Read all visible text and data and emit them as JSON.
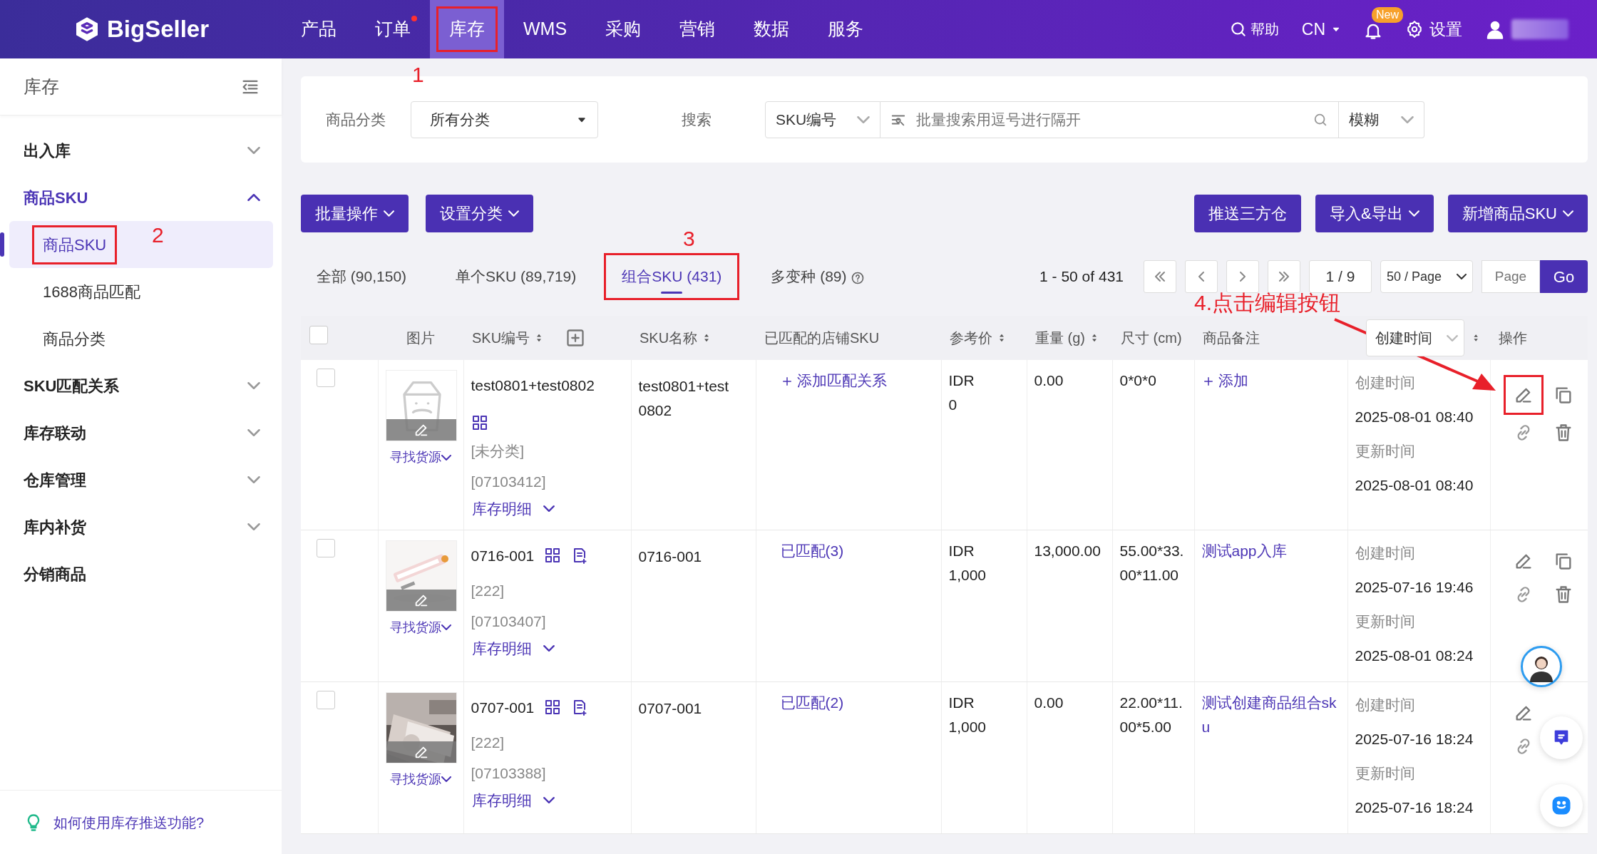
{
  "navbar": {
    "brand": "BigSeller",
    "menu": [
      {
        "label": "产品",
        "selected": false,
        "dot": false,
        "highlight": false
      },
      {
        "label": "订单",
        "selected": false,
        "dot": true,
        "highlight": false
      },
      {
        "label": "库存",
        "selected": true,
        "dot": false,
        "highlight": true
      },
      {
        "label": "WMS",
        "selected": false,
        "dot": false,
        "highlight": false
      },
      {
        "label": "采购",
        "selected": false,
        "dot": false,
        "highlight": false
      },
      {
        "label": "营销",
        "selected": false,
        "dot": false,
        "highlight": false
      },
      {
        "label": "数据",
        "selected": false,
        "dot": false,
        "highlight": false
      },
      {
        "label": "服务",
        "selected": false,
        "dot": false,
        "highlight": false
      }
    ],
    "help": "帮助",
    "language": "CN",
    "new_badge": "New",
    "settings": "设置"
  },
  "sidebar": {
    "title": "库存",
    "items": [
      {
        "label": "出入库",
        "kind": "group",
        "expanded": false,
        "selected": false
      },
      {
        "label": "商品SKU",
        "kind": "group",
        "expanded": true,
        "selected": true,
        "children": [
          {
            "label": "商品SKU",
            "selected": true,
            "highlight": true
          },
          {
            "label": "1688商品匹配",
            "selected": false,
            "highlight": false
          },
          {
            "label": "商品分类",
            "selected": false,
            "highlight": false
          }
        ]
      },
      {
        "label": "SKU匹配关系",
        "kind": "group",
        "expanded": false,
        "selected": false
      },
      {
        "label": "库存联动",
        "kind": "group",
        "expanded": false,
        "selected": false
      },
      {
        "label": "仓库管理",
        "kind": "group",
        "expanded": false,
        "selected": false
      },
      {
        "label": "库内补货",
        "kind": "group",
        "expanded": false,
        "selected": false
      },
      {
        "label": "分销商品",
        "kind": "link",
        "selected": false
      }
    ],
    "tip": "如何使用库存推送功能?"
  },
  "filters": {
    "category_label": "商品分类",
    "category_value": "所有分类",
    "search_label": "搜索",
    "search_type": "SKU编号",
    "search_placeholder": "批量搜索用逗号进行隔开",
    "match_mode": "模糊"
  },
  "actions_left": [
    {
      "label": "批量操作",
      "dropdown": true
    },
    {
      "label": "设置分类",
      "dropdown": true
    }
  ],
  "actions_right": [
    {
      "label": "推送三方仓",
      "dropdown": false
    },
    {
      "label": "导入&导出",
      "dropdown": true
    },
    {
      "label": "新增商品SKU",
      "dropdown": true
    }
  ],
  "tabs": [
    {
      "label": "全部 (90,150)",
      "selected": false,
      "help": false,
      "highlight": false
    },
    {
      "label": "单个SKU (89,719)",
      "selected": false,
      "help": false,
      "highlight": false
    },
    {
      "label": "组合SKU (431)",
      "selected": true,
      "help": false,
      "highlight": true
    },
    {
      "label": "多变种 (89)",
      "selected": false,
      "help": true,
      "highlight": false
    }
  ],
  "pagination": {
    "range": "1 - 50 of 431",
    "page": "1 / 9",
    "page_size": "50 / Page",
    "page_placeholder": "Page",
    "go": "Go"
  },
  "table": {
    "select_all": {
      "checked": false
    },
    "columns": [
      {
        "kind": "checkbox"
      },
      {
        "label": "图片",
        "kind": "plain"
      },
      {
        "label": "SKU编号",
        "kind": "sort_add"
      },
      {
        "label": "SKU名称",
        "kind": "sort"
      },
      {
        "label": "已匹配的店铺SKU",
        "kind": "plain"
      },
      {
        "label": "参考价",
        "kind": "sort"
      },
      {
        "label": "重量 (g)",
        "kind": "sort"
      },
      {
        "label": "尺寸 (cm)",
        "kind": "plain"
      },
      {
        "label": "商品备注",
        "kind": "plain"
      },
      {
        "label": "创建时间",
        "kind": "select"
      },
      {
        "label": "操作",
        "kind": "plain"
      }
    ],
    "rows": [
      {
        "checked": false,
        "has_image": false,
        "find_source": "寻找货源",
        "sku": "test0801+test0802",
        "doc_icon": false,
        "category": "[未分类]",
        "code": "[07103412]",
        "stock_detail": "库存明细",
        "name": "test0801+test0802",
        "matched": {
          "kind": "add",
          "text": "添加匹配关系"
        },
        "price": [
          "IDR",
          "0"
        ],
        "weight": "0.00",
        "size": "0*0*0",
        "note": {
          "kind": "add",
          "text": "添加"
        },
        "created_label": "创建时间",
        "created": "2025-08-01 08:40",
        "updated_label": "更新时间",
        "updated": "2025-08-01 08:40",
        "edit_highlight": true
      },
      {
        "checked": false,
        "has_image": true,
        "find_source": "寻找货源",
        "sku": "0716-001",
        "doc_icon": true,
        "category": "[222]",
        "code": "[07103407]",
        "stock_detail": "库存明细",
        "name": "0716-001",
        "matched": {
          "kind": "link",
          "text": "已匹配(3)"
        },
        "price": [
          "IDR",
          "1,000"
        ],
        "weight": "13,000.00",
        "size": "55.00*33.00*11.00",
        "note": {
          "kind": "link",
          "text": "测试app入库"
        },
        "created_label": "创建时间",
        "created": "2025-07-16 19:46",
        "updated_label": "更新时间",
        "updated": "2025-08-01 08:24",
        "edit_highlight": false
      },
      {
        "checked": false,
        "has_image": true,
        "find_source": "寻找货源",
        "sku": "0707-001",
        "doc_icon": true,
        "category": "[222]",
        "code": "[07103388]",
        "stock_detail": "库存明细",
        "name": "0707-001",
        "matched": {
          "kind": "link",
          "text": "已匹配(2)"
        },
        "price": [
          "IDR",
          "1,000"
        ],
        "weight": "0.00",
        "size": "22.00*11.00*5.00",
        "note": {
          "kind": "link",
          "text": "测试创建商品组合sku"
        },
        "created_label": "创建时间",
        "created": "2025-07-16 18:24",
        "updated_label": "更新时间",
        "updated": "2025-07-16 18:24",
        "edit_highlight": false
      }
    ]
  },
  "annotations": [
    {
      "label": "1",
      "arrow": false
    },
    {
      "label": "2",
      "arrow": false
    },
    {
      "label": "3",
      "arrow": false
    },
    {
      "label": "4.点击编辑按钮",
      "arrow": true
    }
  ]
}
